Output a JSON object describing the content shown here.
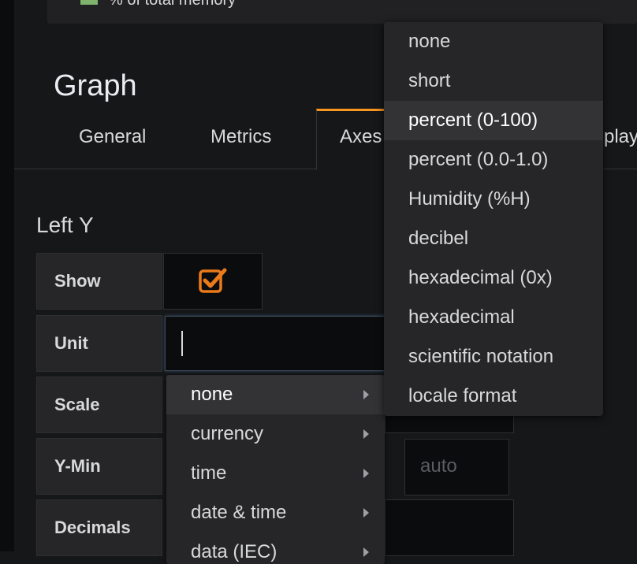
{
  "legend": {
    "label": "% of total memory",
    "swatch_color": "#7eb26d"
  },
  "panel": {
    "title": "Graph"
  },
  "tabs": [
    "General",
    "Metrics",
    "Axes",
    "play"
  ],
  "left_y": {
    "title": "Left Y",
    "show_label": "Show",
    "show_checked": true,
    "unit_label": "Unit",
    "unit_value": "",
    "scale_label": "Scale",
    "ymin_label": "Y-Min",
    "ymin_placeholder": "auto",
    "decimals_label": "Decimals"
  },
  "unit_categories": [
    {
      "label": "none",
      "active": true
    },
    {
      "label": "currency",
      "active": false
    },
    {
      "label": "time",
      "active": false
    },
    {
      "label": "date & time",
      "active": false
    },
    {
      "label": "data (IEC)",
      "active": false
    }
  ],
  "none_units": [
    {
      "label": "none",
      "active": false
    },
    {
      "label": "short",
      "active": false
    },
    {
      "label": "percent (0-100)",
      "active": true
    },
    {
      "label": "percent (0.0-1.0)",
      "active": false
    },
    {
      "label": "Humidity (%H)",
      "active": false
    },
    {
      "label": "decibel",
      "active": false
    },
    {
      "label": "hexadecimal (0x)",
      "active": false
    },
    {
      "label": "hexadecimal",
      "active": false
    },
    {
      "label": "scientific notation",
      "active": false
    },
    {
      "label": "locale format",
      "active": false
    }
  ],
  "colors": {
    "accent": "#f79520",
    "checkbox": "#eb7b18"
  }
}
